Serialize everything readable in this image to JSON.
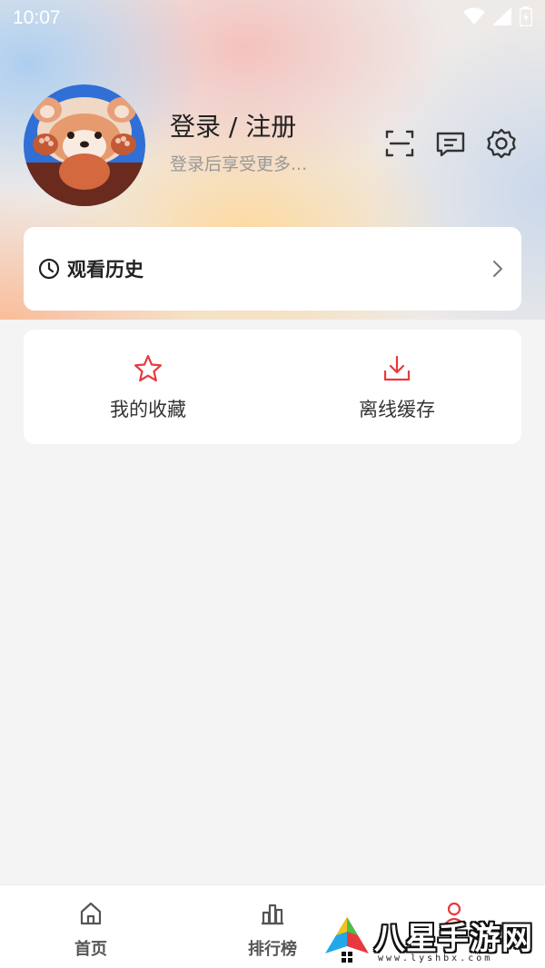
{
  "status_bar": {
    "time": "10:07"
  },
  "profile": {
    "title": "登录 / 注册",
    "subtitle": "登录后享受更多..."
  },
  "top_actions": [
    "scan-icon",
    "message-icon",
    "settings-icon"
  ],
  "history": {
    "label": "观看历史"
  },
  "features": [
    {
      "label": "我的收藏",
      "icon": "star-icon"
    },
    {
      "label": "离线缓存",
      "icon": "download-icon"
    }
  ],
  "bottom_nav": [
    {
      "label": "首页",
      "icon": "home-icon"
    },
    {
      "label": "排行榜",
      "icon": "ranking-icon"
    },
    {
      "label": "",
      "icon": "profile-icon"
    }
  ],
  "watermark": {
    "text": "八星手游网",
    "url": "www.lyshbx.com"
  },
  "colors": {
    "accent": "#e8393d",
    "text": "#222222",
    "muted": "#999999",
    "background": "#f4f4f4"
  }
}
